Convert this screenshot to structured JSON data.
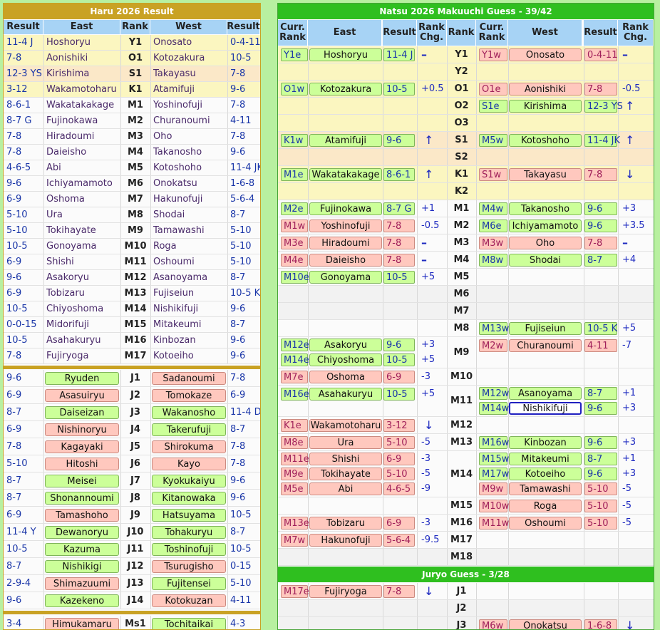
{
  "left": {
    "title": "Haru 2026 Result",
    "headers": [
      "Result",
      "East",
      "Rank",
      "West",
      "Result"
    ],
    "makuuchi": [
      {
        "er": "11-4 J",
        "e": "Hoshoryu",
        "rk": "Y1",
        "w": "Onosato",
        "wr": "0-4-11",
        "bg": "yel"
      },
      {
        "er": "7-8",
        "e": "Aonishiki",
        "rk": "O1",
        "w": "Kotozakura",
        "wr": "10-5",
        "bg": "yel"
      },
      {
        "er": "12-3 YS",
        "e": "Kirishima",
        "rk": "S1",
        "w": "Takayasu",
        "wr": "7-8",
        "bg": "orn"
      },
      {
        "er": "3-12",
        "e": "Wakamotoharu",
        "rk": "K1",
        "w": "Atamifuji",
        "wr": "9-6",
        "bg": "yel"
      },
      {
        "er": "8-6-1",
        "e": "Wakatakakage",
        "rk": "M1",
        "w": "Yoshinofuji",
        "wr": "7-8",
        "bg": "wh"
      },
      {
        "er": "8-7 G",
        "e": "Fujinokawa",
        "rk": "M2",
        "w": "Churanoumi",
        "wr": "4-11",
        "bg": "wh"
      },
      {
        "er": "7-8",
        "e": "Hiradoumi",
        "rk": "M3",
        "w": "Oho",
        "wr": "7-8",
        "bg": "wh"
      },
      {
        "er": "7-8",
        "e": "Daieisho",
        "rk": "M4",
        "w": "Takanosho",
        "wr": "9-6",
        "bg": "wh"
      },
      {
        "er": "4-6-5",
        "e": "Abi",
        "rk": "M5",
        "w": "Kotoshoho",
        "wr": "11-4 JK",
        "bg": "wh"
      },
      {
        "er": "9-6",
        "e": "Ichiyamamoto",
        "rk": "M6",
        "w": "Onokatsu",
        "wr": "1-6-8",
        "bg": "wh"
      },
      {
        "er": "6-9",
        "e": "Oshoma",
        "rk": "M7",
        "w": "Hakunofuji",
        "wr": "5-6-4",
        "bg": "wh"
      },
      {
        "er": "5-10",
        "e": "Ura",
        "rk": "M8",
        "w": "Shodai",
        "wr": "8-7",
        "bg": "wh"
      },
      {
        "er": "5-10",
        "e": "Tokihayate",
        "rk": "M9",
        "w": "Tamawashi",
        "wr": "5-10",
        "bg": "wh"
      },
      {
        "er": "10-5",
        "e": "Gonoyama",
        "rk": "M10",
        "w": "Roga",
        "wr": "5-10",
        "bg": "wh"
      },
      {
        "er": "6-9",
        "e": "Shishi",
        "rk": "M11",
        "w": "Oshoumi",
        "wr": "5-10",
        "bg": "wh"
      },
      {
        "er": "9-6",
        "e": "Asakoryu",
        "rk": "M12",
        "w": "Asanoyama",
        "wr": "8-7",
        "bg": "wh"
      },
      {
        "er": "6-9",
        "e": "Tobizaru",
        "rk": "M13",
        "w": "Fujiseiun",
        "wr": "10-5 K",
        "bg": "wh"
      },
      {
        "er": "10-5",
        "e": "Chiyoshoma",
        "rk": "M14",
        "w": "Nishikifuji",
        "wr": "9-6",
        "bg": "wh"
      },
      {
        "er": "0-0-15",
        "e": "Midorifuji",
        "rk": "M15",
        "w": "Mitakeumi",
        "wr": "8-7",
        "bg": "wh"
      },
      {
        "er": "10-5",
        "e": "Asahakuryu",
        "rk": "M16",
        "w": "Kinbozan",
        "wr": "9-6",
        "bg": "wh"
      },
      {
        "er": "7-8",
        "e": "Fujiryoga",
        "rk": "M17",
        "w": "Kotoeiho",
        "wr": "9-6",
        "bg": "wh"
      }
    ],
    "juryo": [
      {
        "er": "9-6",
        "e": "Ryuden",
        "ec": "g",
        "rk": "J1",
        "w": "Sadanoumi",
        "wc": "p",
        "wr": "7-8"
      },
      {
        "er": "6-9",
        "e": "Asasuiryu",
        "ec": "p",
        "rk": "J2",
        "w": "Tomokaze",
        "wc": "p",
        "wr": "6-9"
      },
      {
        "er": "8-7",
        "e": "Daiseizan",
        "ec": "g",
        "rk": "J3",
        "w": "Wakanosho",
        "wc": "g",
        "wr": "11-4 D"
      },
      {
        "er": "6-9",
        "e": "Nishinoryu",
        "ec": "p",
        "rk": "J4",
        "w": "Takerufuji",
        "wc": "g",
        "wr": "8-7"
      },
      {
        "er": "7-8",
        "e": "Kagayaki",
        "ec": "p",
        "rk": "J5",
        "w": "Shirokuma",
        "wc": "p",
        "wr": "7-8"
      },
      {
        "er": "5-10",
        "e": "Hitoshi",
        "ec": "p",
        "rk": "J6",
        "w": "Kayo",
        "wc": "p",
        "wr": "7-8"
      },
      {
        "er": "8-7",
        "e": "Meisei",
        "ec": "g",
        "rk": "J7",
        "w": "Kyokukaiyu",
        "wc": "g",
        "wr": "9-6"
      },
      {
        "er": "8-7",
        "e": "Shonannoumi",
        "ec": "g",
        "rk": "J8",
        "w": "Kitanowaka",
        "wc": "g",
        "wr": "9-6"
      },
      {
        "er": "6-9",
        "e": "Tamashoho",
        "ec": "p",
        "rk": "J9",
        "w": "Hatsuyama",
        "wc": "g",
        "wr": "10-5"
      },
      {
        "er": "11-4 Y",
        "e": "Dewanoryu",
        "ec": "g",
        "rk": "J10",
        "w": "Tohakuryu",
        "wc": "g",
        "wr": "8-7"
      },
      {
        "er": "10-5",
        "e": "Kazuma",
        "ec": "g",
        "rk": "J11",
        "w": "Toshinofuji",
        "wc": "g",
        "wr": "10-5"
      },
      {
        "er": "8-7",
        "e": "Nishikigi",
        "ec": "g",
        "rk": "J12",
        "w": "Tsurugisho",
        "wc": "p",
        "wr": "0-15"
      },
      {
        "er": "2-9-4",
        "e": "Shimazuumi",
        "ec": "p",
        "rk": "J13",
        "w": "Fujitensei",
        "wc": "g",
        "wr": "5-10"
      },
      {
        "er": "9-6",
        "e": "Kazekeno",
        "ec": "g",
        "rk": "J14",
        "w": "Kotokuzan",
        "wc": "p",
        "wr": "4-11"
      }
    ],
    "makushita": [
      {
        "er": "3-4",
        "e": "Himukamaru",
        "ec": "p",
        "rk": "Ms1",
        "w": "Tochitaikai",
        "wc": "g",
        "wr": "4-3"
      }
    ]
  },
  "right": {
    "title": "Natsu 2026 Makuuchi Guess - 39/42",
    "juryo_title": "Juryo Guess - 3/28",
    "headers": [
      "Curr. Rank",
      "East",
      "Result",
      "Rank Chg.",
      "Rank",
      "Curr. Rank",
      "West",
      "Result",
      "Rank Chg."
    ],
    "rows": [
      {
        "rk": "Y1",
        "bg": "yel",
        "east": [
          {
            "cr": "Y1e",
            "n": "Hoshoryu",
            "r": "11-4 J",
            "c": "g",
            "chg": "–"
          }
        ],
        "west": [
          {
            "cr": "Y1w",
            "n": "Onosato",
            "r": "0-4-11",
            "c": "p",
            "chg": "–"
          }
        ]
      },
      {
        "rk": "Y2",
        "bg": "yel",
        "east": [],
        "west": []
      },
      {
        "rk": "O1",
        "bg": "yel",
        "east": [
          {
            "cr": "O1w",
            "n": "Kotozakura",
            "r": "10-5",
            "c": "g",
            "chg": "+0.5"
          }
        ],
        "west": [
          {
            "cr": "O1e",
            "n": "Aonishiki",
            "r": "7-8",
            "c": "p",
            "chg": "-0.5"
          }
        ]
      },
      {
        "rk": "O2",
        "bg": "yel",
        "east": [],
        "west": [
          {
            "cr": "S1e",
            "n": "Kirishima",
            "r": "12-3 YS",
            "c": "g",
            "chg": "↑"
          }
        ]
      },
      {
        "rk": "O3",
        "bg": "yel",
        "east": [],
        "west": []
      },
      {
        "rk": "S1",
        "bg": "orn",
        "east": [
          {
            "cr": "K1w",
            "n": "Atamifuji",
            "r": "9-6",
            "c": "g",
            "chg": "↑"
          }
        ],
        "west": [
          {
            "cr": "M5w",
            "n": "Kotoshoho",
            "r": "11-4 JK",
            "c": "g",
            "chg": "↑"
          }
        ]
      },
      {
        "rk": "S2",
        "bg": "orn",
        "east": [],
        "west": []
      },
      {
        "rk": "K1",
        "bg": "yel",
        "east": [
          {
            "cr": "M1e",
            "n": "Wakatakakage",
            "r": "8-6-1",
            "c": "g",
            "chg": "↑"
          }
        ],
        "west": [
          {
            "cr": "S1w",
            "n": "Takayasu",
            "r": "7-8",
            "c": "p",
            "chg": "↓"
          }
        ]
      },
      {
        "rk": "K2",
        "bg": "yel",
        "east": [],
        "west": []
      },
      {
        "rk": "M1",
        "bg": "wh",
        "east": [
          {
            "cr": "M2e",
            "n": "Fujinokawa",
            "r": "8-7 G",
            "c": "g",
            "chg": "+1"
          }
        ],
        "west": [
          {
            "cr": "M4w",
            "n": "Takanosho",
            "r": "9-6",
            "c": "g",
            "chg": "+3"
          }
        ]
      },
      {
        "rk": "M2",
        "bg": "wh",
        "east": [
          {
            "cr": "M1w",
            "n": "Yoshinofuji",
            "r": "7-8",
            "c": "p",
            "chg": "-0.5"
          }
        ],
        "west": [
          {
            "cr": "M6e",
            "n": "Ichiyamamoto",
            "r": "9-6",
            "c": "g",
            "chg": "+3.5"
          }
        ]
      },
      {
        "rk": "M3",
        "bg": "wh",
        "east": [
          {
            "cr": "M3e",
            "n": "Hiradoumi",
            "r": "7-8",
            "c": "p",
            "chg": "–"
          }
        ],
        "west": [
          {
            "cr": "M3w",
            "n": "Oho",
            "r": "7-8",
            "c": "p",
            "chg": "–"
          }
        ]
      },
      {
        "rk": "M4",
        "bg": "wh",
        "east": [
          {
            "cr": "M4e",
            "n": "Daieisho",
            "r": "7-8",
            "c": "p",
            "chg": "–"
          }
        ],
        "west": [
          {
            "cr": "M8w",
            "n": "Shodai",
            "r": "8-7",
            "c": "g",
            "chg": "+4"
          }
        ]
      },
      {
        "rk": "M5",
        "bg": "wh",
        "east": [
          {
            "cr": "M10e",
            "n": "Gonoyama",
            "r": "10-5",
            "c": "g",
            "chg": "+5"
          }
        ],
        "west": []
      },
      {
        "rk": "M6",
        "bg": "gy",
        "east": [],
        "west": []
      },
      {
        "rk": "M7",
        "bg": "gy",
        "east": [],
        "west": []
      },
      {
        "rk": "M8",
        "bg": "wh",
        "east": [],
        "west": [
          {
            "cr": "M13w",
            "n": "Fujiseiun",
            "r": "10-5 K",
            "c": "g",
            "chg": "+5"
          }
        ]
      },
      {
        "rk": "M9",
        "bg": "wh",
        "east": [
          {
            "cr": "M12e",
            "n": "Asakoryu",
            "r": "9-6",
            "c": "g",
            "chg": "+3"
          },
          {
            "cr": "M14e",
            "n": "Chiyoshoma",
            "r": "10-5",
            "c": "g",
            "chg": "+5"
          }
        ],
        "west": [
          {
            "cr": "M2w",
            "n": "Churanoumi",
            "r": "4-11",
            "c": "p",
            "chg": "-7"
          }
        ]
      },
      {
        "rk": "M10",
        "bg": "wh",
        "east": [
          {
            "cr": "M7e",
            "n": "Oshoma",
            "r": "6-9",
            "c": "p",
            "chg": "-3"
          }
        ],
        "west": []
      },
      {
        "rk": "M11",
        "bg": "wh",
        "east": [
          {
            "cr": "M16e",
            "n": "Asahakuryu",
            "r": "10-5",
            "c": "g",
            "chg": "+5"
          }
        ],
        "west": [
          {
            "cr": "M12w",
            "n": "Asanoyama",
            "r": "8-7",
            "c": "g",
            "chg": "+1"
          },
          {
            "cr": "M14w",
            "n": "Nishikifuji",
            "r": "9-6",
            "c": "g",
            "chg": "+3",
            "sel": true
          }
        ]
      },
      {
        "rk": "M12",
        "bg": "wh",
        "east": [
          {
            "cr": "K1e",
            "n": "Wakamotoharu",
            "r": "3-12",
            "c": "p",
            "chg": "↓"
          }
        ],
        "west": []
      },
      {
        "rk": "M13",
        "bg": "wh",
        "east": [
          {
            "cr": "M8e",
            "n": "Ura",
            "r": "5-10",
            "c": "p",
            "chg": "-5"
          }
        ],
        "west": [
          {
            "cr": "M16w",
            "n": "Kinbozan",
            "r": "9-6",
            "c": "g",
            "chg": "+3"
          }
        ]
      },
      {
        "rk": "M14",
        "bg": "wh",
        "east": [
          {
            "cr": "M11e",
            "n": "Shishi",
            "r": "6-9",
            "c": "p",
            "chg": "-3"
          },
          {
            "cr": "M9e",
            "n": "Tokihayate",
            "r": "5-10",
            "c": "p",
            "chg": "-5"
          },
          {
            "cr": "M5e",
            "n": "Abi",
            "r": "4-6-5",
            "c": "p",
            "chg": "-9"
          }
        ],
        "west": [
          {
            "cr": "M15w",
            "n": "Mitakeumi",
            "r": "8-7",
            "c": "g",
            "chg": "+1"
          },
          {
            "cr": "M17w",
            "n": "Kotoeiho",
            "r": "9-6",
            "c": "g",
            "chg": "+3"
          },
          {
            "cr": "M9w",
            "n": "Tamawashi",
            "r": "5-10",
            "c": "p",
            "chg": "-5"
          }
        ]
      },
      {
        "rk": "M15",
        "bg": "wh",
        "east": [],
        "west": [
          {
            "cr": "M10w",
            "n": "Roga",
            "r": "5-10",
            "c": "p",
            "chg": "-5"
          }
        ]
      },
      {
        "rk": "M16",
        "bg": "wh",
        "east": [
          {
            "cr": "M13e",
            "n": "Tobizaru",
            "r": "6-9",
            "c": "p",
            "chg": "-3"
          }
        ],
        "west": [
          {
            "cr": "M11w",
            "n": "Oshoumi",
            "r": "5-10",
            "c": "p",
            "chg": "-5"
          }
        ]
      },
      {
        "rk": "M17",
        "bg": "wh",
        "east": [
          {
            "cr": "M7w",
            "n": "Hakunofuji",
            "r": "5-6-4",
            "c": "p",
            "chg": "-9.5"
          }
        ],
        "west": []
      },
      {
        "rk": "M18",
        "bg": "gy",
        "east": [],
        "west": []
      }
    ],
    "juryo_rows": [
      {
        "rk": "J1",
        "bg": "wh",
        "east": [
          {
            "cr": "M17e",
            "n": "Fujiryoga",
            "r": "7-8",
            "c": "p",
            "chg": "↓"
          }
        ],
        "west": []
      },
      {
        "rk": "J2",
        "bg": "gy",
        "east": [],
        "west": []
      },
      {
        "rk": "J3",
        "bg": "gy",
        "east": [],
        "west": [
          {
            "cr": "M6w",
            "n": "Onokatsu",
            "r": "1-6-8",
            "c": "p",
            "chg": "↓"
          }
        ]
      }
    ]
  }
}
